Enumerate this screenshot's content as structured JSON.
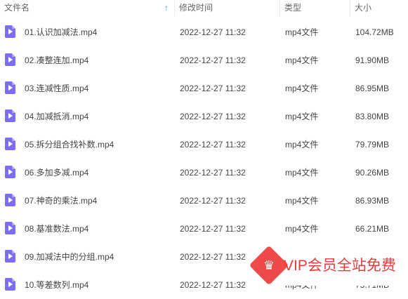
{
  "columns": {
    "name": "文件名",
    "modified": "修改时间",
    "type": "类型",
    "size": "大小"
  },
  "files": [
    {
      "name": "01.认识加减法.mp4",
      "modified": "2022-12-27 11:32",
      "type": "mp4文件",
      "size": "104.72MB"
    },
    {
      "name": "02.凑整连加.mp4",
      "modified": "2022-12-27 11:32",
      "type": "mp4文件",
      "size": "91.90MB"
    },
    {
      "name": "03.连减性质.mp4",
      "modified": "2022-12-27 11:32",
      "type": "mp4文件",
      "size": "86.95MB"
    },
    {
      "name": "04.加减抵消.mp4",
      "modified": "2022-12-27 11:32",
      "type": "mp4文件",
      "size": "83.80MB"
    },
    {
      "name": "05.拆分组合找补数.mp4",
      "modified": "2022-12-27 11:32",
      "type": "mp4文件",
      "size": "79.79MB"
    },
    {
      "name": "06.多加多减.mp4",
      "modified": "2022-12-27 11:32",
      "type": "mp4文件",
      "size": "90.26MB"
    },
    {
      "name": "07.神奇的乘法.mp4",
      "modified": "2022-12-27 11:32",
      "type": "mp4文件",
      "size": "86.93MB"
    },
    {
      "name": "08.基准数法.mp4",
      "modified": "2022-12-27 11:32",
      "type": "mp4文件",
      "size": "66.21MB"
    },
    {
      "name": "09.加减法中的分组.mp4",
      "modified": "2022-12-27 11:32",
      "type": "mp4文件",
      "size": ""
    },
    {
      "name": "10.等差数列.mp4",
      "modified": "2022-12-27 11:32",
      "type": "mp4文件",
      "size": "75.71MB"
    }
  ],
  "promo": {
    "text": "VIP会员全站免费",
    "color": "#e83c3c"
  },
  "icons": {
    "file": "video-file-icon",
    "sort": "sort-ascending-icon"
  }
}
